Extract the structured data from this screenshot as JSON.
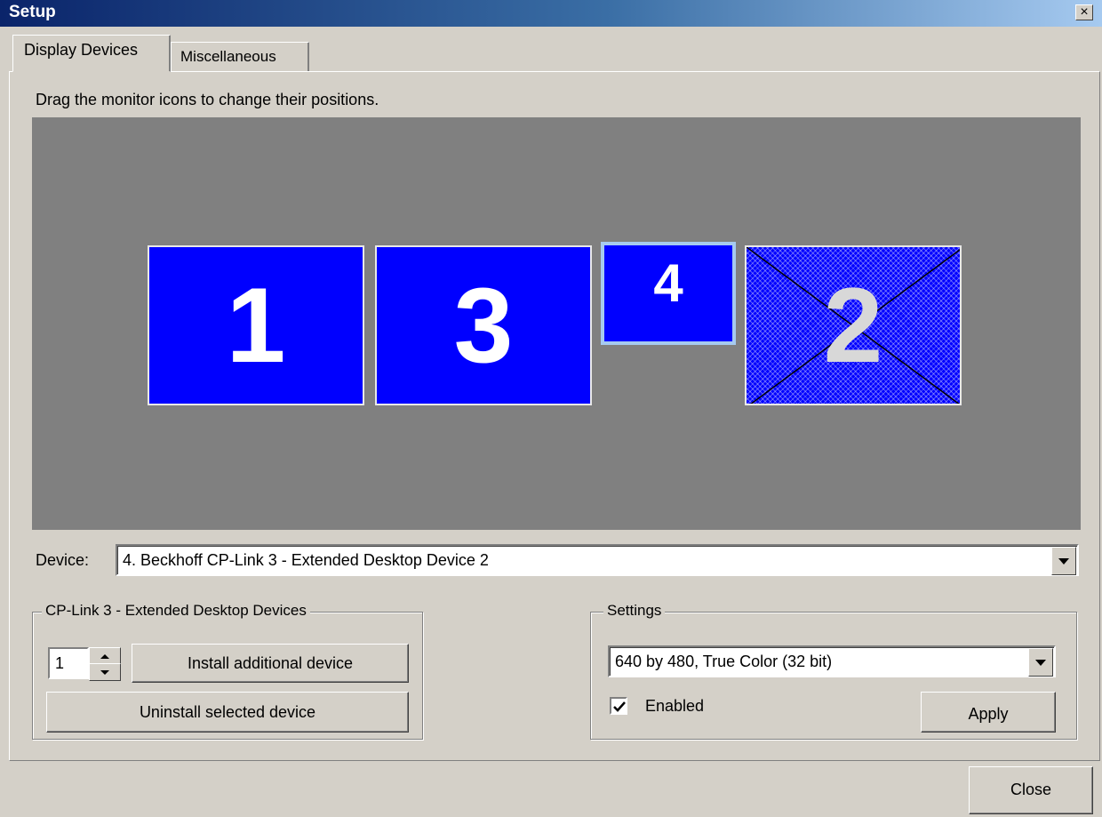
{
  "window": {
    "title": "Setup",
    "close_glyph": "×"
  },
  "tabs": [
    {
      "label": "Display Devices",
      "active": true
    },
    {
      "label": "Miscellaneous",
      "active": false
    }
  ],
  "display_devices": {
    "hint": "Drag the monitor icons to change their positions.",
    "monitors": [
      {
        "label": "1",
        "state": "enabled"
      },
      {
        "label": "3",
        "state": "enabled"
      },
      {
        "label": "4",
        "state": "selected"
      },
      {
        "label": "2",
        "state": "disabled"
      }
    ],
    "device_label": "Device:",
    "device_value": "4. Beckhoff CP-Link 3 - Extended Desktop Device 2"
  },
  "cp_link_group": {
    "title": "CP-Link 3 - Extended Desktop Devices",
    "spinner_value": "1",
    "install_label": "Install additional device",
    "uninstall_label": "Uninstall selected device"
  },
  "settings_group": {
    "title": "Settings",
    "mode_value": "640 by 480, True Color (32 bit)",
    "enabled_label": "Enabled",
    "enabled_checked": true,
    "apply_label": "Apply"
  },
  "footer": {
    "close_label": "Close"
  },
  "colors": {
    "monitor_fill": "#0000ff",
    "area_bg": "#808080",
    "window_bg": "#d4d0c8",
    "title_bar": "#0a246a"
  },
  "icons": [
    "close-icon",
    "dropdown-arrow-icon",
    "spin-up-icon",
    "spin-down-icon",
    "checkmark-icon"
  ]
}
